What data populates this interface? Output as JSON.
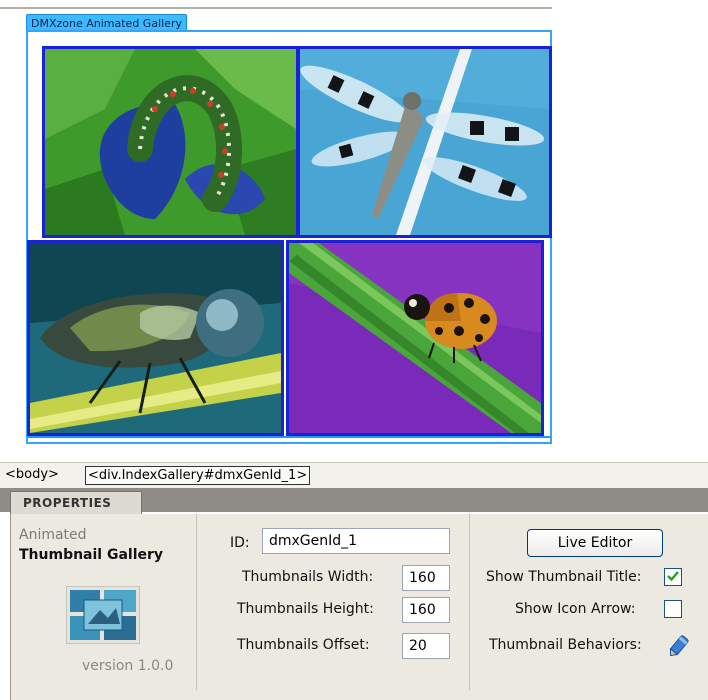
{
  "gallery": {
    "tag_label": "DMXzone Animated Gallery",
    "thumbnails": [
      {
        "name": "caterpillar",
        "border_color": "#1a22d8"
      },
      {
        "name": "dragonfly",
        "border_color": "#1a22d8"
      },
      {
        "name": "dragonfly-closeup",
        "border_color": "#1a22d8"
      },
      {
        "name": "ladybug",
        "border_color": "#1a22d8"
      }
    ]
  },
  "tag_selector": {
    "tags": [
      "<body>",
      "<div.IndexGallery#dmxGenId_1>"
    ]
  },
  "properties": {
    "tab_label": "PROPERTIES",
    "component": {
      "subtitle": "Animated",
      "title": "Thumbnail Gallery",
      "icon": "gallery-thumbnail-icon",
      "version": "version 1.0.0"
    },
    "fields": {
      "id_label": "ID:",
      "id_value": "dmxGenId_1",
      "width_label": "Thumbnails Width:",
      "width_value": "160",
      "height_label": "Thumbnails Height:",
      "height_value": "160",
      "offset_label": "Thumbnails Offset:",
      "offset_value": "20"
    },
    "options": {
      "live_editor_label": "Live Editor",
      "show_title_label": "Show Thumbnail Title:",
      "show_title_checked": true,
      "show_arrow_label": "Show Icon Arrow:",
      "show_arrow_checked": false,
      "behaviors_label": "Thumbnail Behaviors:",
      "behaviors_icon": "pencil-icon"
    }
  },
  "colors": {
    "accent": "#33a5ff",
    "thumb_border": "#1a22d8",
    "panel_bg": "#eceae0",
    "header_bg": "#8f8c87"
  }
}
